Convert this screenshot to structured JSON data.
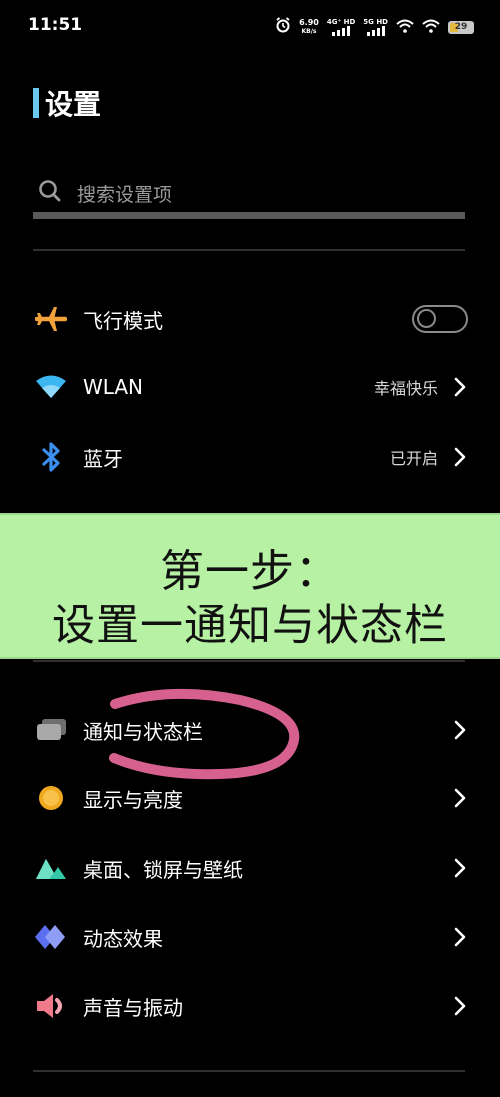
{
  "status_bar": {
    "time": "11:51",
    "net_speed_value": "6.90",
    "net_speed_unit": "KB/s",
    "sim1_label": "4G⁺ HD",
    "sim2_label": "5G HD",
    "battery_level": "29"
  },
  "header": {
    "title": "设置",
    "accent_color": "#6dc8f0"
  },
  "search": {
    "placeholder": "搜索设置项"
  },
  "settings_group1": [
    {
      "label": "飞行模式",
      "icon": "airplane-icon",
      "control": "toggle",
      "toggle_on": false
    },
    {
      "label": "WLAN",
      "icon": "wifi-icon",
      "value": "幸福快乐"
    },
    {
      "label": "蓝牙",
      "icon": "bluetooth-icon",
      "value": "已开启"
    }
  ],
  "settings_group2": [
    {
      "label": "通知与状态栏",
      "icon": "notification-icon"
    },
    {
      "label": "显示与亮度",
      "icon": "brightness-icon"
    },
    {
      "label": "桌面、锁屏与壁纸",
      "icon": "wallpaper-icon"
    },
    {
      "label": "动态效果",
      "icon": "animation-icon"
    },
    {
      "label": "声音与振动",
      "icon": "sound-icon"
    }
  ],
  "overlay": {
    "line1": "第一步：",
    "line2": "设置一通知与状态栏",
    "background_color": "#b7f2a4",
    "highlight_color": "#e8699b"
  }
}
